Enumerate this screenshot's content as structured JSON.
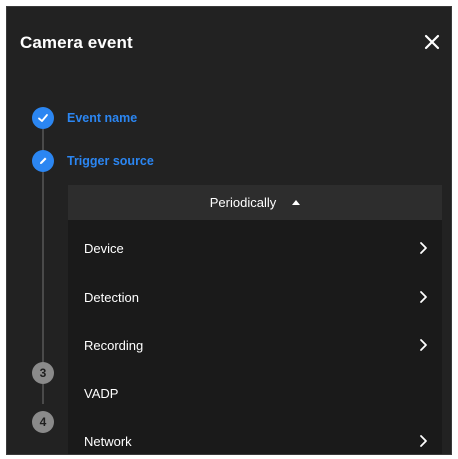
{
  "dialog": {
    "title": "Camera event",
    "close_icon": "close-icon"
  },
  "steps": [
    {
      "status": "done",
      "icon": "check-icon",
      "label": "Event name"
    },
    {
      "status": "active",
      "icon": "pencil-icon",
      "label": "Trigger source"
    },
    {
      "status": "pending",
      "number": "3"
    },
    {
      "status": "pending",
      "number": "4"
    }
  ],
  "trigger_dropdown": {
    "selected": "Periodically",
    "icon": "caret-up-icon",
    "options": [
      {
        "label": "Device",
        "has_submenu": true
      },
      {
        "label": "Detection",
        "has_submenu": true
      },
      {
        "label": "Recording",
        "has_submenu": true
      },
      {
        "label": "VADP",
        "has_submenu": false
      },
      {
        "label": "Network",
        "has_submenu": true
      }
    ]
  },
  "colors": {
    "panel_bg": "#222222",
    "accent": "#2b86f2",
    "menu_bg": "#1a1a1a",
    "dropdown_header_bg": "#2d2d2d"
  }
}
